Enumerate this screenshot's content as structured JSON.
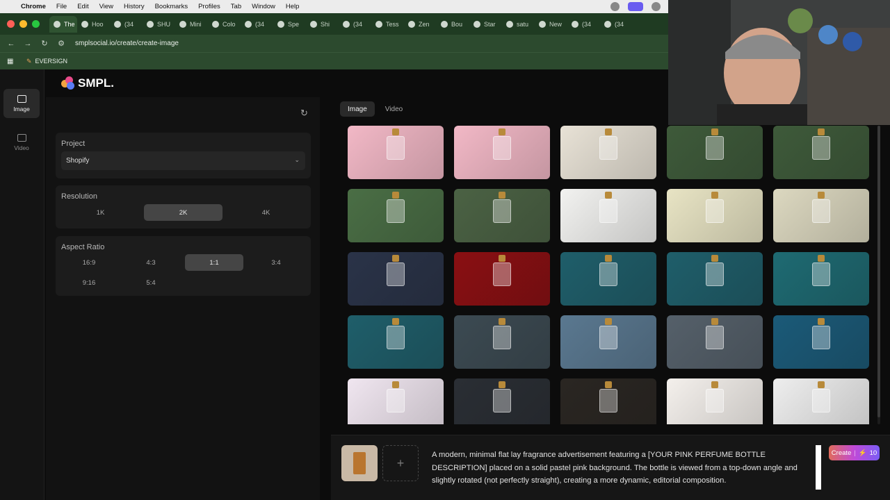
{
  "menubar": {
    "app": "Chrome",
    "items": [
      "File",
      "Edit",
      "View",
      "History",
      "Bookmarks",
      "Profiles",
      "Tab",
      "Window",
      "Help"
    ]
  },
  "browser": {
    "tabs": [
      "The",
      "Hoo",
      "(34",
      "SHU",
      "Mini",
      "Colo",
      "(34",
      "Spe",
      "Shi",
      "(34",
      "Tess",
      "Zen",
      "Bou",
      "Star",
      "satu",
      "New",
      "(34",
      "(34"
    ],
    "url": "smplsocial.io/create/create-image",
    "bookmark": "EVERSIGN"
  },
  "app": {
    "logo": "SMPL.",
    "rail": [
      {
        "label": "Image"
      },
      {
        "label": "Video"
      }
    ],
    "project": {
      "title": "Project",
      "value": "Shopify"
    },
    "resolution": {
      "title": "Resolution",
      "options": [
        "1K",
        "2K",
        "4K"
      ],
      "selected": "2K"
    },
    "aspect": {
      "title": "Aspect Ratio",
      "options": [
        "16:9",
        "4:3",
        "1:1",
        "3:4",
        "9:16",
        "5:4"
      ],
      "selected": "1:1"
    },
    "media_tabs": [
      "Image",
      "Video"
    ],
    "prompt": "A modern, minimal flat lay fragrance advertisement featuring a [YOUR PINK PERFUME BOTTLE DESCRIPTION] placed on a solid pastel pink background. The bottle is viewed from a top-down angle and slightly rotated (not perfectly straight), creating a more dynamic, editorial composition.",
    "create_label": "Create",
    "create_credits": "10"
  },
  "thumb_colors": [
    "#f2b8c6",
    "#f2b8c6",
    "#e8e2d6",
    "#3e5a3a",
    "#3e5a3a",
    "#4a6e45",
    "#4b6244",
    "#f2f2f0",
    "#e8e4c4",
    "#dcd8c0",
    "#2a3348",
    "#8a0f12",
    "#1f5e6a",
    "#1f5e6a",
    "#1e6a72",
    "#1f5e6a",
    "#3c4a52",
    "#5a7890",
    "#55606a",
    "#1b5a78",
    "#f0e6f0",
    "#2a2e34",
    "#2a2622",
    "#f4f0ec",
    "#eeeeee"
  ],
  "colors": {
    "accent": "#7a5cf5",
    "tabbar": "#1f3b22",
    "panel_bg": "#121212"
  }
}
